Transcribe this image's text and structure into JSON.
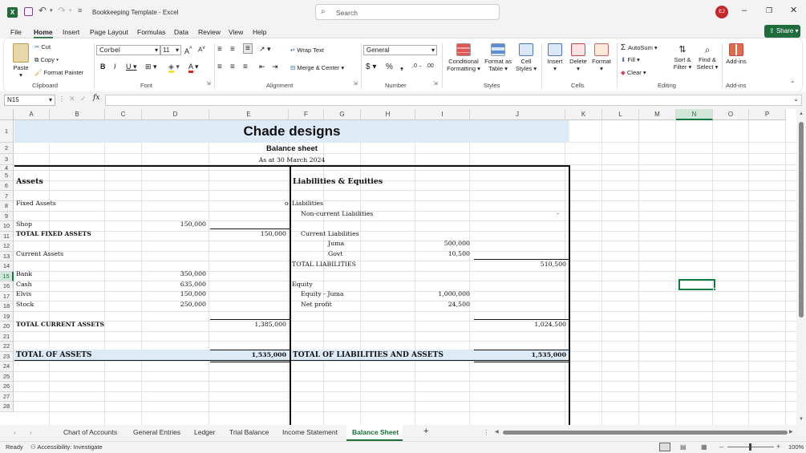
{
  "titlebar": {
    "doc_title": "Bookkeeping Template  -  Excel",
    "search_placeholder": "Search",
    "user_initials": "EJ",
    "share_label": "Share"
  },
  "menu": [
    "File",
    "Home",
    "Insert",
    "Page Layout",
    "Formulas",
    "Data",
    "Review",
    "View",
    "Help"
  ],
  "menu_active": "Home",
  "ribbon": {
    "paste": "Paste",
    "cut": "Cut",
    "copy": "Copy",
    "format_painter": "Format Painter",
    "clipboard": "Clipboard",
    "font_name": "Corbel",
    "font_size": "11",
    "font": "Font",
    "wrap_text": "Wrap Text",
    "merge_center": "Merge & Center",
    "alignment": "Alignment",
    "number_format": "General",
    "number": "Number",
    "conditional_formatting": "Conditional Formatting",
    "format_as_table": "Format as Table",
    "cell_styles": "Cell Styles",
    "styles": "Styles",
    "insert": "Insert",
    "delete": "Delete",
    "format": "Format",
    "cells": "Cells",
    "autosum": "AutoSum",
    "fill": "Fill",
    "clear": "Clear",
    "sort_filter": "Sort & Filter",
    "find_select": "Find & Select",
    "editing": "Editing",
    "addins": "Add-ins",
    "addins_group": "Add-ins"
  },
  "formula_bar": {
    "name_box": "N15",
    "fx": "fx",
    "value": ""
  },
  "columns": [
    "A",
    "B",
    "C",
    "D",
    "E",
    "F",
    "G",
    "H",
    "I",
    "J",
    "K",
    "L",
    "M",
    "N",
    "O",
    "P"
  ],
  "rows": [
    "1",
    "2",
    "3",
    "4",
    "5",
    "6",
    "7",
    "8",
    "9",
    "10",
    "11",
    "12",
    "13",
    "14",
    "15",
    "16",
    "17",
    "18",
    "19",
    "20",
    "21",
    "22",
    "23",
    "24",
    "25",
    "26",
    "27",
    "28"
  ],
  "sheet": {
    "title": "Chade designs",
    "subtitle": "Balance sheet",
    "date": "As at 30 March 2024",
    "assets_header": "Assets",
    "liab_header": "Liabilities & Equities",
    "fixed_assets": "Fixed Assets",
    "o_mark": "o",
    "liabilities": "Liabilities",
    "noncurrent": "Non-current Liabilities",
    "noncurrent_val": "-",
    "shop": "Shop",
    "shop_val": "150,000",
    "total_fixed": "TOTAL FIXED ASSETS",
    "total_fixed_val": "150,000",
    "current_liab": "Current Liabilities",
    "juma": "Juma",
    "juma_val": "500,000",
    "current_assets": "Current Assets",
    "govt": "Govt",
    "govt_val": "10,500",
    "total_liab": "TOTAL LIABILITIES",
    "total_liab_val": "510,500",
    "bank": "Bank",
    "bank_val": "350,000",
    "cash": "Cash",
    "cash_val": "635,000",
    "equity": "Equity",
    "elvis": "Elvis",
    "elvis_val": "150,000",
    "equity_juma": "Equity - Juma",
    "equity_juma_val": "1,000,000",
    "stock": "Stock",
    "stock_val": "250,000",
    "net_profit": "Net profit",
    "net_profit_val": "24,500",
    "total_current": "TOTAL CURRENT ASSETS",
    "total_current_val": "1,385,000",
    "total_equity_val": "1,024,500",
    "total_assets": "TOTAL OF ASSETS",
    "total_assets_val": "1,535,000",
    "total_liab_assets": "TOTAL OF LIABILITIES AND ASSETS",
    "total_liab_assets_val": "1,535,000"
  },
  "tabs": [
    "Chart of Accounts",
    "General Entries",
    "Ledger",
    "Trial Balance",
    "Income Statement",
    "Balance Sheet"
  ],
  "active_tab": "Balance Sheet",
  "status": {
    "ready": "Ready",
    "accessibility": "Accessibility: Investigate",
    "zoom": "100%"
  },
  "colors": {
    "accent_green": "#1d6c3a",
    "band_blue": "#ddebf7",
    "selection_green": "#107c41"
  }
}
